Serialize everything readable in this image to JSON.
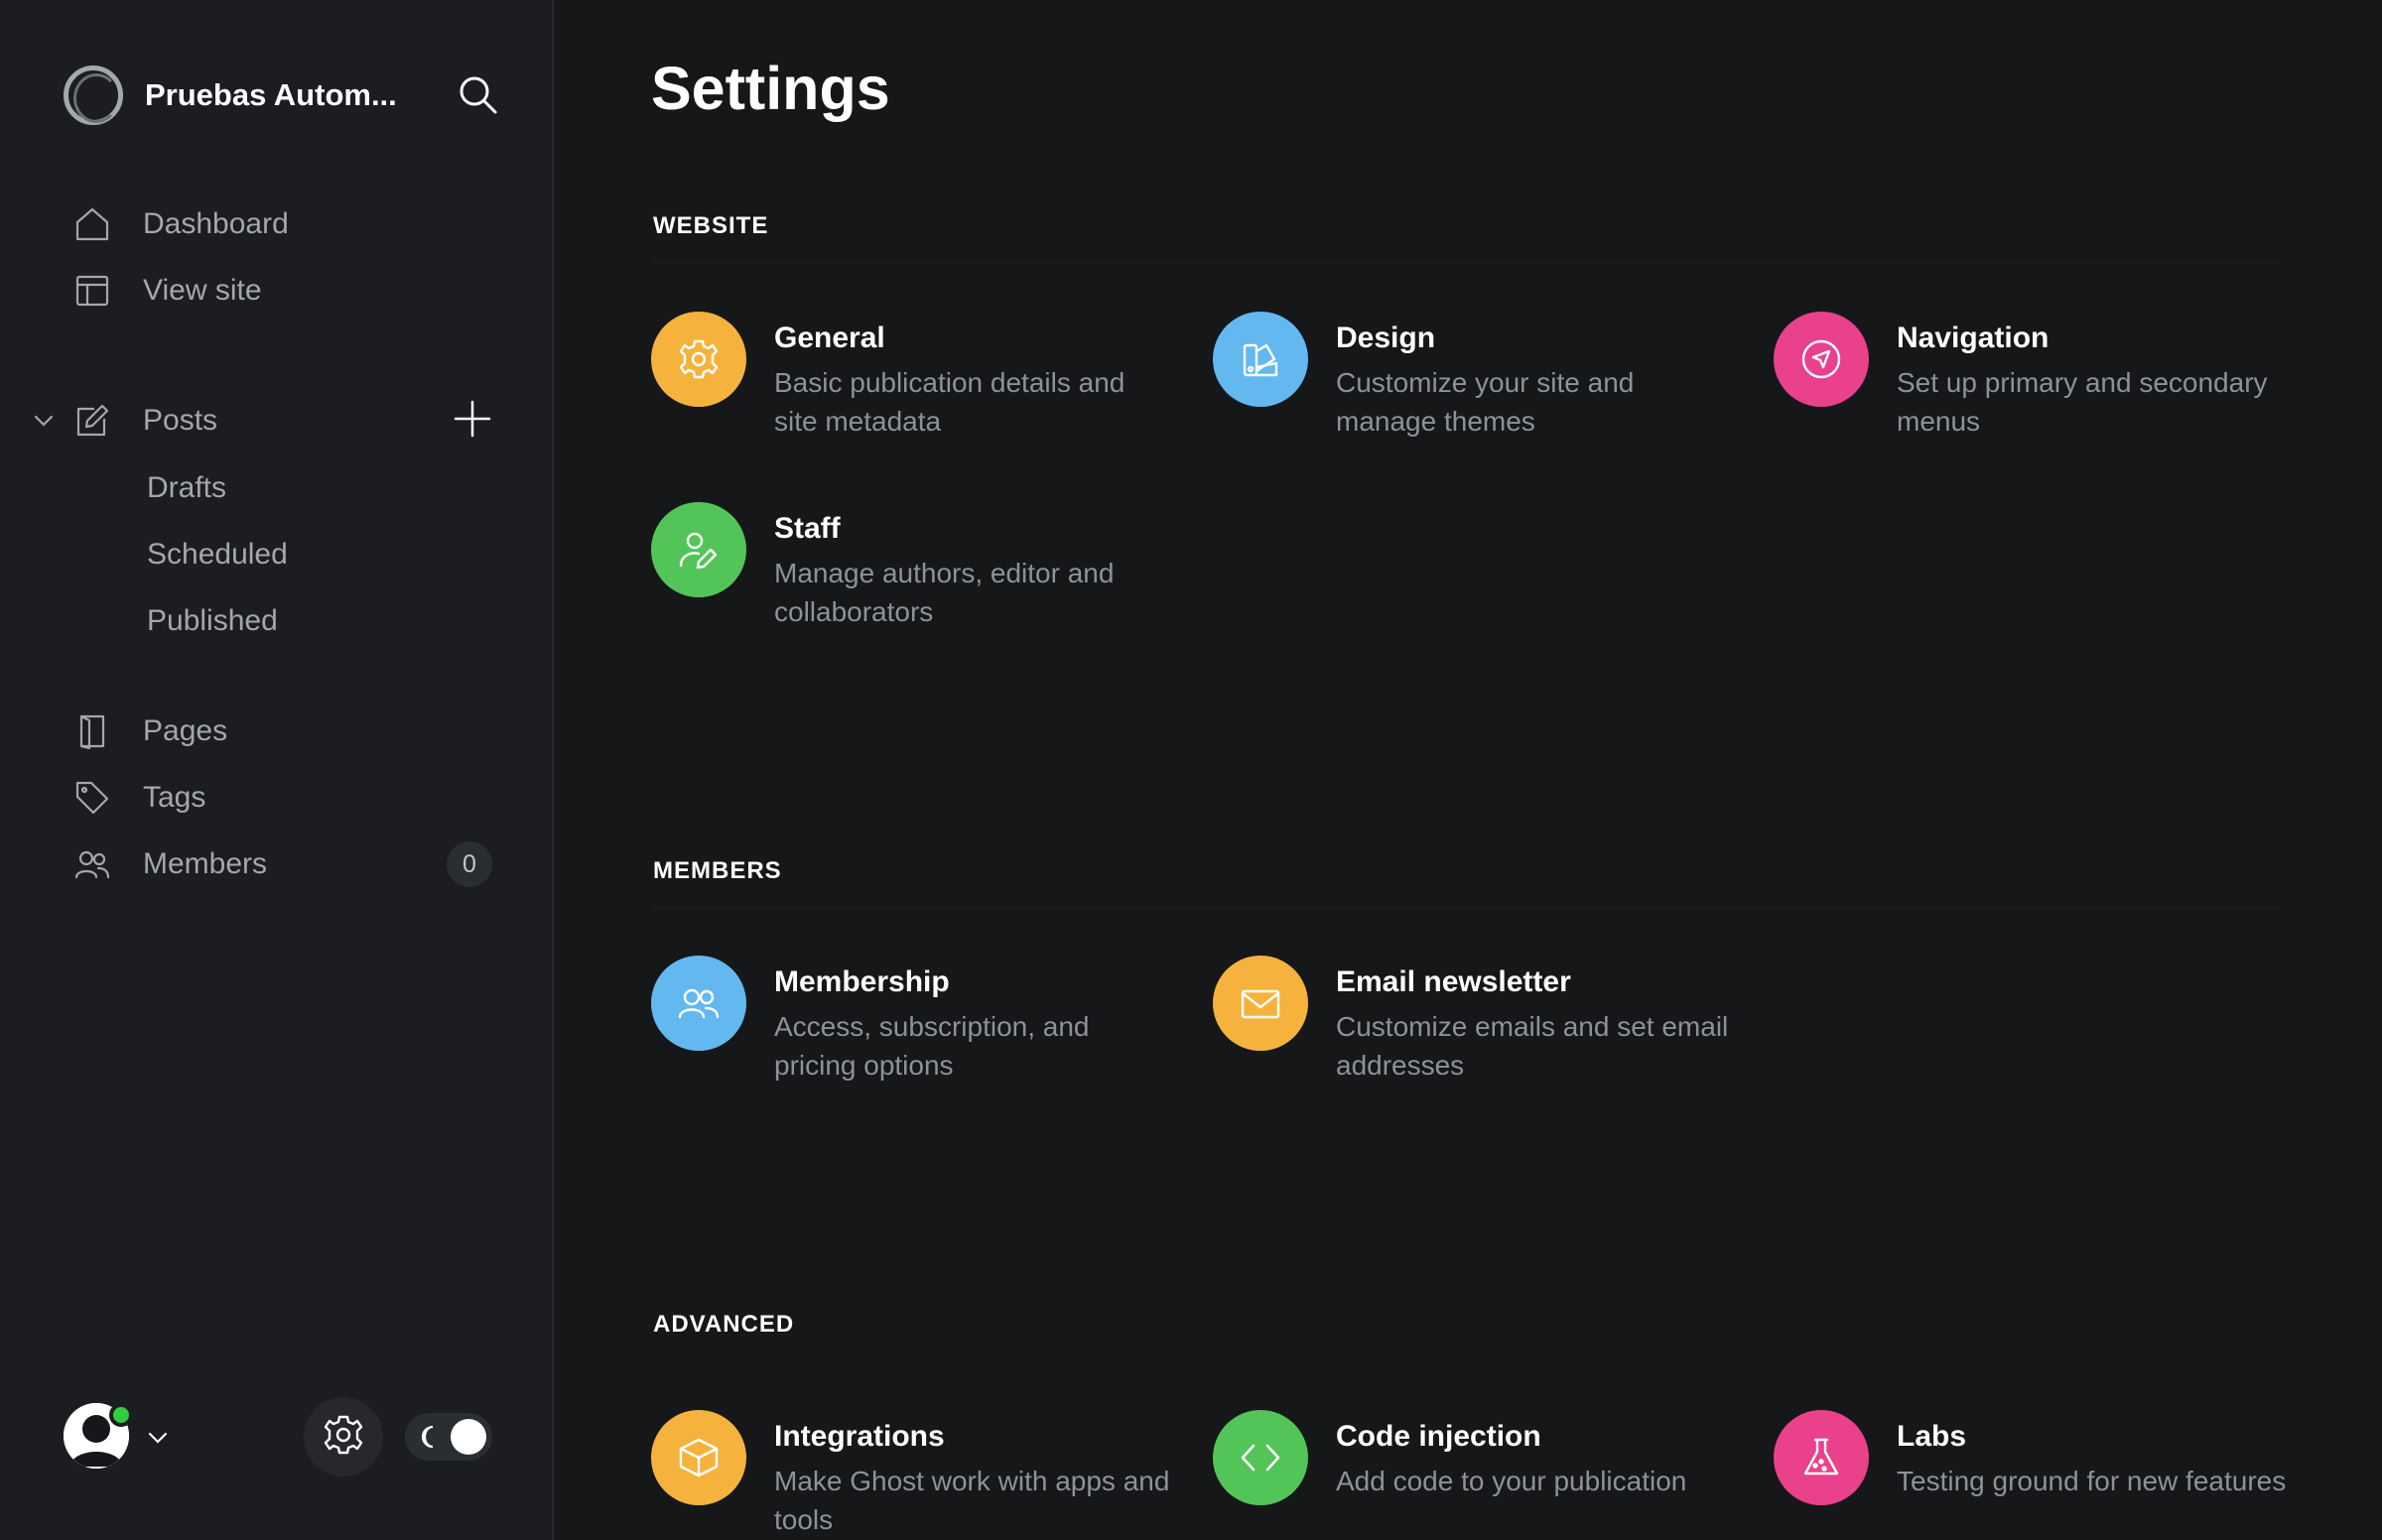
{
  "sidebar": {
    "brand_name": "Pruebas Autom...",
    "nav": {
      "dashboard": "Dashboard",
      "view_site": "View site",
      "posts": "Posts",
      "drafts": "Drafts",
      "scheduled": "Scheduled",
      "published": "Published",
      "pages": "Pages",
      "tags": "Tags",
      "members": "Members",
      "members_count": "0"
    }
  },
  "main": {
    "title": "Settings",
    "sections": {
      "website": {
        "title": "WEBSITE",
        "items": [
          {
            "title": "General",
            "desc": "Basic publication details and site metadata",
            "color": "#f5b33d",
            "icon": "gear-icon"
          },
          {
            "title": "Design",
            "desc": "Customize your site and manage themes",
            "color": "#63b8f0",
            "icon": "palette-icon"
          },
          {
            "title": "Navigation",
            "desc": "Set up primary and secondary menus",
            "color": "#e9418b",
            "icon": "compass-icon"
          },
          {
            "title": "Staff",
            "desc": "Manage authors, editor and collaborators",
            "color": "#53c558",
            "icon": "user-edit-icon"
          }
        ]
      },
      "members": {
        "title": "MEMBERS",
        "items": [
          {
            "title": "Membership",
            "desc": "Access, subscription, and pricing options",
            "color": "#63b8f0",
            "icon": "users-icon"
          },
          {
            "title": "Email newsletter",
            "desc": "Customize emails and set email addresses",
            "color": "#f5b33d",
            "icon": "envelope-icon"
          }
        ]
      },
      "advanced": {
        "title": "ADVANCED",
        "items": [
          {
            "title": "Integrations",
            "desc": "Make Ghost work with apps and tools",
            "color": "#f5b33d",
            "icon": "box-icon"
          },
          {
            "title": "Code injection",
            "desc": "Add code to your publication",
            "color": "#53c558",
            "icon": "code-icon"
          },
          {
            "title": "Labs",
            "desc": "Testing ground for new features",
            "color": "#e9418b",
            "icon": "flask-icon"
          }
        ]
      }
    }
  },
  "colors": {
    "sidebar_bg": "#1c1d20",
    "main_bg": "#151719",
    "text_muted": "#a4a7ab",
    "status_online": "#30cf43"
  }
}
